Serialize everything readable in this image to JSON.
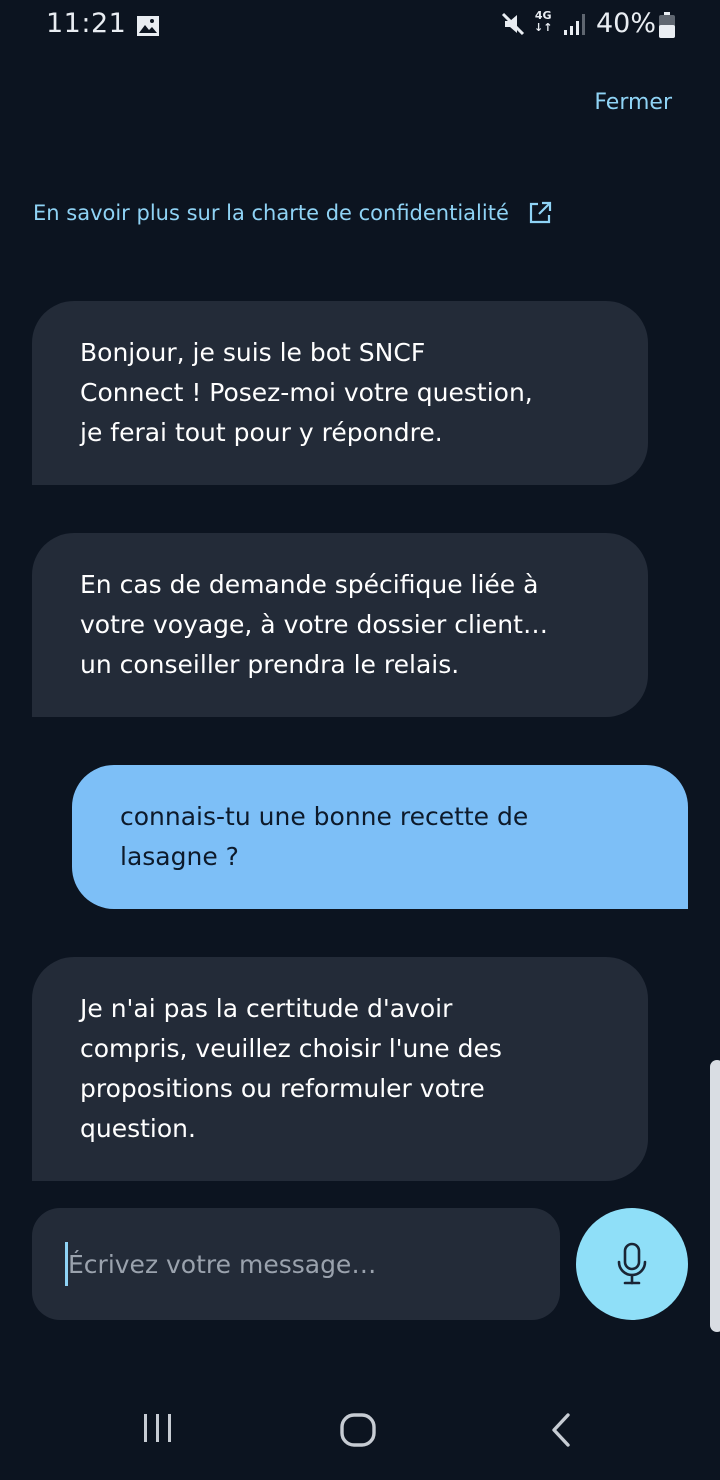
{
  "status_bar": {
    "time": "11:21",
    "network": "4G",
    "battery": "40%",
    "icons": [
      "gallery-icon",
      "mute-icon",
      "signal-icon",
      "battery-icon"
    ]
  },
  "header": {
    "close_label": "Fermer"
  },
  "privacy_link": {
    "label": "En savoir plus sur la charte de confidentialité",
    "icon": "external-link-icon"
  },
  "messages": [
    {
      "from": "bot",
      "text": "Bonjour, je suis le bot SNCF\nConnect ! Posez-moi votre question,\nje ferai tout pour y répondre."
    },
    {
      "from": "bot",
      "text": "En cas de demande spécifique liée à\nvotre voyage, à votre dossier client…\nun conseiller prendra le relais."
    },
    {
      "from": "user",
      "text": "connais-tu une bonne recette de\nlasagne ?"
    },
    {
      "from": "bot",
      "text": "Je n'ai pas la certitude d'avoir\ncompris, veuillez choisir l'une des\npropositions ou reformuler votre\nquestion."
    }
  ],
  "composer": {
    "placeholder": "Écrivez votre message…",
    "value": "",
    "mic_icon": "microphone-icon"
  },
  "colors": {
    "background": "#0c1420",
    "bot_bubble": "#232b38",
    "user_bubble": "#7dbff7",
    "link": "#8fd3f5",
    "mic_button": "#8fdff8"
  },
  "navigation": {
    "buttons": [
      "recent-apps-icon",
      "home-icon",
      "back-icon"
    ]
  }
}
